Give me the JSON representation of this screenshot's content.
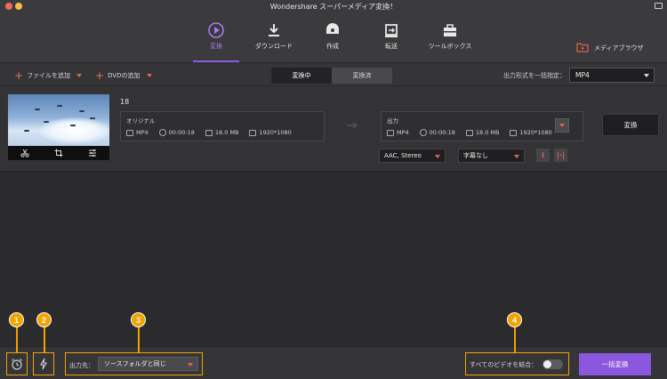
{
  "window": {
    "title": "Wondershare スーパーメディア変換！"
  },
  "nav": {
    "items": [
      {
        "label": "変換",
        "icon": "convert-icon",
        "active": true
      },
      {
        "label": "ダウンロード",
        "icon": "download-icon",
        "active": false
      },
      {
        "label": "作成",
        "icon": "burn-icon",
        "active": false
      },
      {
        "label": "転送",
        "icon": "transfer-icon",
        "active": false
      },
      {
        "label": "ツールボックス",
        "icon": "toolbox-icon",
        "active": false
      }
    ],
    "media_browser": "メディアブラウザ"
  },
  "toolbar": {
    "add_file": "ファイルを追加",
    "add_dvd": "DVDの追加",
    "tabs": [
      "変換中",
      "変換済"
    ],
    "active_tab": "変換中",
    "format_label": "出力形式を一括指定：",
    "format_value": "MP4"
  },
  "task": {
    "file_name": "18",
    "original": {
      "heading": "オリジナル",
      "format": "MP4",
      "duration": "00:00:18",
      "size": "18.0 MB",
      "resolution": "1920*1080"
    },
    "output": {
      "heading": "出力",
      "format": "MP4",
      "duration": "00:00:18",
      "size": "18.0 MB",
      "resolution": "1920*1080"
    },
    "audio": "AAC, Stereo",
    "subtitle": "字幕なし",
    "convert_button": "変換"
  },
  "bottom": {
    "output_label": "出力先：",
    "output_value": "ソースフォルダと同じ",
    "merge_label": "すべてのビデオを結合：",
    "merge_enabled": false,
    "batch_button": "一括変換"
  },
  "markers": [
    "1",
    "2",
    "3",
    "4"
  ],
  "colors": {
    "accent": "#8a57de",
    "highlight": "#f2a300",
    "caret": "#e0654e"
  }
}
